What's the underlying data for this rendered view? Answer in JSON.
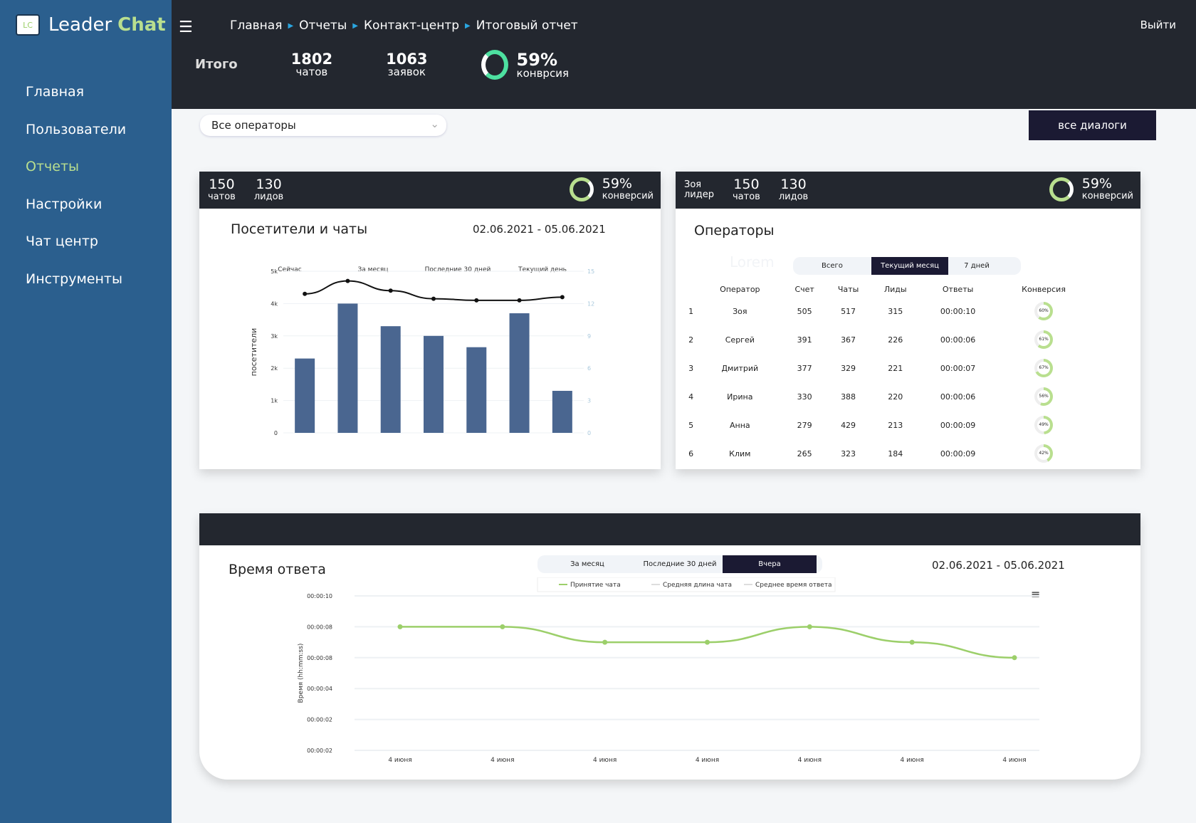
{
  "app": {
    "logo_mark": "LC",
    "name1": "Leader",
    "name2": "Chat"
  },
  "sidebar": {
    "items": [
      {
        "label": "Главная"
      },
      {
        "label": "Пользователи"
      },
      {
        "label": "Отчеты",
        "active": true
      },
      {
        "label": "Настройки"
      },
      {
        "label": "Чат центр"
      },
      {
        "label": "Инструменты"
      }
    ]
  },
  "header": {
    "breadcrumbs": [
      "Главная",
      "Отчеты",
      "Контакт-центр",
      "Итоговый отчет"
    ],
    "logout": "Выйти",
    "total_label": "Итого",
    "chats": {
      "value": "1802",
      "label": "чатов"
    },
    "requests": {
      "value": "1063",
      "label": "заявок"
    },
    "conversion": {
      "value": "59%",
      "label": "конврсия",
      "fraction": 0.59
    }
  },
  "filters": {
    "operator_select": "Все операторы",
    "all_dialogs": "все диалоги"
  },
  "visitors_card": {
    "chats": "150",
    "chats_label": "чатов",
    "leads": "130",
    "leads_label": "лидов",
    "conversion": "59%",
    "conversion_label": "конверсий",
    "title": "Посетители и чаты",
    "date_from": "02.06.2021",
    "date_sep": "-",
    "date_to": "05.06.2021",
    "period_tabs": [
      "Сейчас",
      "За месяц",
      "Последние 30 дней",
      "Текущий день"
    ]
  },
  "operators_card": {
    "leader_name": "Зоя",
    "leader_label": "лидер",
    "chats": "150",
    "chats_label": "чатов",
    "leads": "130",
    "leads_label": "лидов",
    "conversion": "59%",
    "conversion_label": "конверсий",
    "title": "Операторы",
    "ghost_text": "Lorem",
    "tabs": [
      "Всего",
      "Текущий месяц",
      "7 дней"
    ],
    "active_tab": 1,
    "columns": [
      "",
      "Оператор",
      "Счет",
      "Чаты",
      "Лиды",
      "Ответы",
      "Конверсия"
    ],
    "rows": [
      [
        "1",
        "Зоя",
        "505",
        "517",
        "315",
        "00:00:10",
        "60%"
      ],
      [
        "2",
        "Сергей",
        "391",
        "367",
        "226",
        "00:00:06",
        "61%"
      ],
      [
        "3",
        "Дмитрий",
        "377",
        "329",
        "221",
        "00:00:07",
        "67%"
      ],
      [
        "4",
        "Ирина",
        "330",
        "388",
        "220",
        "00:00:06",
        "56%"
      ],
      [
        "5",
        "Анна",
        "279",
        "429",
        "213",
        "00:00:09",
        "49%"
      ],
      [
        "6",
        "Клим",
        "265",
        "323",
        "184",
        "00:00:09",
        "42%"
      ]
    ]
  },
  "response_card": {
    "title": "Время ответа",
    "tabs": [
      "За месяц",
      "Последние 30 дней",
      "Вчера"
    ],
    "active_tab": 2,
    "date_from": "02.06.2021",
    "date_sep": "-",
    "date_to": "05.06.2021",
    "menu_icon": "hamburger-icon"
  },
  "colors": {
    "sidebar": "#2b5f8e",
    "dark": "#23272f",
    "accent_green": "#9ccf6a",
    "bar": "#4a6690",
    "ring_teal": "#4de0a0"
  },
  "chart_data": [
    {
      "type": "bar",
      "ylabel": "посетители",
      "categories": [
        "",
        "",
        "",
        "",
        "",
        "",
        ""
      ],
      "yticks": [
        "0",
        "1k",
        "2k",
        "3k",
        "4k",
        "5k"
      ],
      "ylim": [
        0,
        5000
      ],
      "values": [
        2300,
        4000,
        3300,
        3000,
        2650,
        3700,
        1300
      ],
      "secondary": {
        "type": "line",
        "yticks": [
          "0",
          "3",
          "6",
          "9",
          "12",
          "15"
        ],
        "ylim": [
          0,
          15
        ],
        "values": [
          12.9,
          14.1,
          13.2,
          12.45,
          12.3,
          12.3,
          12.6
        ]
      },
      "grid": true
    },
    {
      "type": "line",
      "ylabel": "Время (hh:mm:ss)",
      "yticks": [
        "00:00:02",
        "00:00:02",
        "00:00:04",
        "00:00:08",
        "00:00:08",
        "00:00:10"
      ],
      "ylim": [
        0,
        10
      ],
      "categories": [
        "4 июня",
        "4 июня",
        "4 июня",
        "4 июня",
        "4 июня",
        "4 июня",
        "4 июня"
      ],
      "series": [
        {
          "name": "Принятие чата",
          "values": [
            8,
            8,
            7,
            7,
            8,
            7,
            6
          ],
          "color": "#9ccf6a"
        },
        {
          "name": "Средняя длина чата",
          "values": [],
          "color": "#dddddd"
        },
        {
          "name": "Среднее время ответа",
          "values": [],
          "color": "#dddddd"
        }
      ],
      "legend": "top",
      "grid": true
    }
  ]
}
